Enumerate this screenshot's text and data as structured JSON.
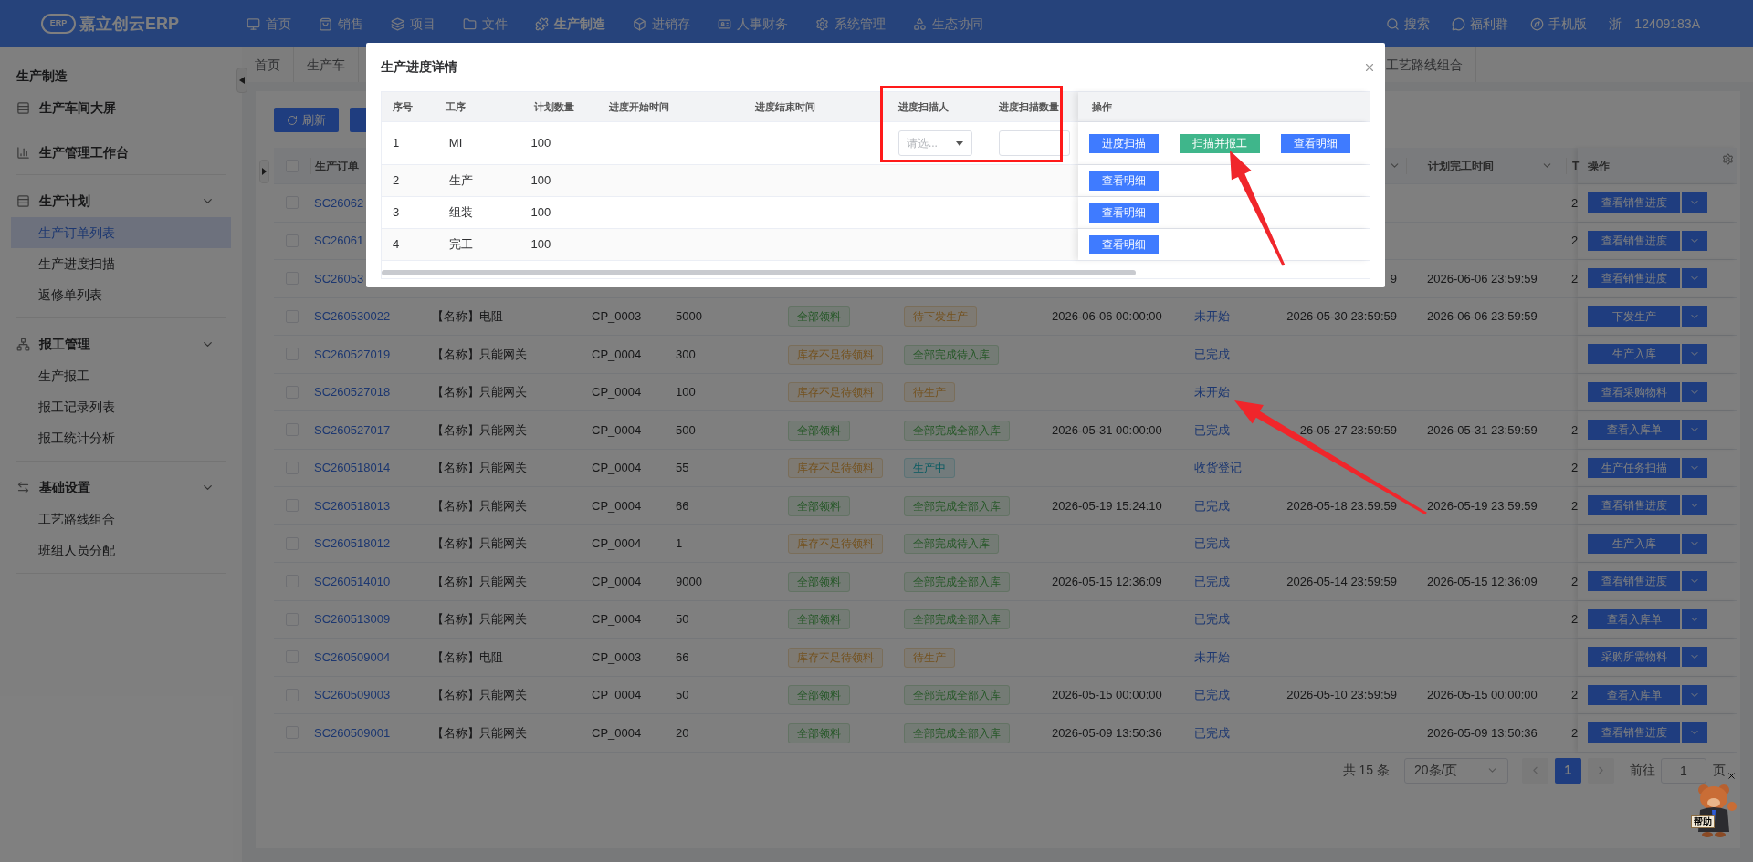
{
  "top_nav": {
    "logo": {
      "mark": "ERP",
      "name": "嘉立创云ERP"
    },
    "menu": [
      {
        "label": "首页",
        "selected": false
      },
      {
        "label": "销售",
        "selected": false
      },
      {
        "label": "项目",
        "selected": false
      },
      {
        "label": "文件",
        "selected": false
      },
      {
        "label": "生产制造",
        "selected": true
      },
      {
        "label": "进销存",
        "selected": false
      },
      {
        "label": "人事财务",
        "selected": false
      },
      {
        "label": "系统管理",
        "selected": false
      },
      {
        "label": "生态协同",
        "selected": false
      }
    ],
    "tools": [
      "搜索",
      "福利群",
      "手机版"
    ],
    "region": "浙",
    "user": "12409183A"
  },
  "sidebar": {
    "title": "生产制造",
    "items": [
      {
        "label": "生产车间大屏"
      },
      {
        "label": "生产管理工作台"
      },
      {
        "label": "生产计划",
        "expanded": true,
        "children": [
          {
            "label": "生产订单列表",
            "selected": true
          },
          {
            "label": "生产进度扫描",
            "selected": false
          },
          {
            "label": "返修单列表",
            "selected": false
          }
        ]
      },
      {
        "label": "报工管理",
        "expanded": true,
        "children": [
          {
            "label": "生产报工",
            "selected": false
          },
          {
            "label": "报工记录列表",
            "selected": false
          },
          {
            "label": "报工统计分析",
            "selected": false
          }
        ]
      },
      {
        "label": "基础设置",
        "expanded": true,
        "children": [
          {
            "label": "工艺路线组合",
            "selected": false
          },
          {
            "label": "班组人员分配",
            "selected": false
          }
        ]
      }
    ]
  },
  "tabs": [
    {
      "label": "首页"
    },
    {
      "label": "生产车"
    },
    {
      "label": "工艺路线组合"
    }
  ],
  "toolbar": {
    "buttons": [
      "刷新"
    ]
  },
  "table": {
    "select_all_checked": false,
    "columns": {
      "order_no": "生产订单",
      "planned_finish": "计划完工时间",
      "column_12": "T",
      "actions": "操作"
    },
    "rows": [
      {
        "checked": false,
        "order_no": "SC26062",
        "column_12": "2",
        "action": "查看销售进度"
      },
      {
        "checked": false,
        "order_no": "SC26061",
        "column_12": "2",
        "action": "查看销售进度"
      },
      {
        "checked": false,
        "order_no": "SC26053",
        "column_10": "9",
        "planned_finish": "2026-06-06 23:59:59",
        "column_12": "2",
        "action": "查看销售进度"
      },
      {
        "checked": false,
        "order_no": "SC260530022",
        "column_3": "【名称】电阻",
        "column_4": "CP_0003",
        "column_5": "5000",
        "column_6": {
          "text": "全部领料",
          "kind": "success"
        },
        "column_7": {
          "text": "待下发生产",
          "kind": "warning"
        },
        "column_8": "2026-06-06 00:00:00",
        "column_9": "未开始",
        "column_10": "2026-05-30 23:59:59",
        "planned_finish": "2026-06-06 23:59:59",
        "action": "下发生产"
      },
      {
        "checked": false,
        "order_no": "SC260527019",
        "column_3": "【名称】只能网关",
        "column_4": "CP_0004",
        "column_5": "300",
        "column_6": {
          "text": "库存不足待领料",
          "kind": "warning"
        },
        "column_7": {
          "text": "全部完成待入库",
          "kind": "success"
        },
        "column_9": "已完成",
        "action": "生产入库"
      },
      {
        "checked": false,
        "order_no": "SC260527018",
        "column_3": "【名称】只能网关",
        "column_4": "CP_0004",
        "column_5": "100",
        "column_6": {
          "text": "库存不足待领料",
          "kind": "warning"
        },
        "column_7": {
          "text": "待生产",
          "kind": "warning"
        },
        "column_9": "未开始",
        "action": "查看采购物料"
      },
      {
        "checked": false,
        "order_no": "SC260527017",
        "column_3": "【名称】只能网关",
        "column_4": "CP_0004",
        "column_5": "500",
        "column_6": {
          "text": "全部领料",
          "kind": "success"
        },
        "column_7": {
          "text": "全部完成全部入库",
          "kind": "success"
        },
        "column_8": "2026-05-31 00:00:00",
        "column_9": "已完成",
        "column_10": "26-05-27 23:59:59",
        "planned_finish": "2026-05-31 23:59:59",
        "column_12": "2",
        "action": "查看入库单"
      },
      {
        "checked": false,
        "order_no": "SC260518014",
        "column_3": "【名称】只能网关",
        "column_4": "CP_0004",
        "column_5": "55",
        "column_6": {
          "text": "库存不足待领料",
          "kind": "warning"
        },
        "column_7": {
          "text": "生产中",
          "kind": "info"
        },
        "column_9": "收货登记",
        "column_12": "2",
        "action": "生产任务扫描"
      },
      {
        "checked": false,
        "order_no": "SC260518013",
        "column_3": "【名称】只能网关",
        "column_4": "CP_0004",
        "column_5": "66",
        "column_6": {
          "text": "全部领料",
          "kind": "success"
        },
        "column_7": {
          "text": "全部完成全部入库",
          "kind": "success"
        },
        "column_8": "2026-05-19 15:24:10",
        "column_9": "已完成",
        "column_10": "2026-05-18 23:59:59",
        "planned_finish": "2026-05-19 23:59:59",
        "column_12": "2",
        "action": "查看销售进度"
      },
      {
        "checked": false,
        "order_no": "SC260518012",
        "column_3": "【名称】只能网关",
        "column_4": "CP_0004",
        "column_5": "1",
        "column_6": {
          "text": "库存不足待领料",
          "kind": "warning"
        },
        "column_7": {
          "text": "全部完成待入库",
          "kind": "success"
        },
        "column_9": "已完成",
        "action": "生产入库"
      },
      {
        "checked": false,
        "order_no": "SC260514010",
        "column_3": "【名称】只能网关",
        "column_4": "CP_0004",
        "column_5": "9000",
        "column_6": {
          "text": "全部领料",
          "kind": "success"
        },
        "column_7": {
          "text": "全部完成全部入库",
          "kind": "success"
        },
        "column_8": "2026-05-15 12:36:09",
        "column_9": "已完成",
        "column_10": "2026-05-14 23:59:59",
        "planned_finish": "2026-05-15 12:36:09",
        "column_12": "2",
        "action": "查看销售进度"
      },
      {
        "checked": false,
        "order_no": "SC260513009",
        "column_3": "【名称】只能网关",
        "column_4": "CP_0004",
        "column_5": "50",
        "column_6": {
          "text": "全部领料",
          "kind": "success"
        },
        "column_7": {
          "text": "全部完成全部入库",
          "kind": "success"
        },
        "column_9": "已完成",
        "column_12": "2",
        "action": "查看入库单"
      },
      {
        "checked": false,
        "order_no": "SC260509004",
        "column_3": "【名称】电阻",
        "column_4": "CP_0003",
        "column_5": "66",
        "column_6": {
          "text": "库存不足待领料",
          "kind": "warning"
        },
        "column_7": {
          "text": "待生产",
          "kind": "warning"
        },
        "column_9": "未开始",
        "action": "采购所需物料"
      },
      {
        "checked": false,
        "order_no": "SC260509003",
        "column_3": "【名称】只能网关",
        "column_4": "CP_0004",
        "column_5": "50",
        "column_6": {
          "text": "全部领料",
          "kind": "success"
        },
        "column_7": {
          "text": "全部完成全部入库",
          "kind": "success"
        },
        "column_8": "2026-05-15 00:00:00",
        "column_9": "已完成",
        "column_10": "2026-05-10 23:59:59",
        "planned_finish": "2026-05-15 00:00:00",
        "column_12": "2",
        "action": "查看入库单"
      },
      {
        "checked": false,
        "order_no": "SC260509001",
        "column_3": "【名称】只能网关",
        "column_4": "CP_0004",
        "column_5": "20",
        "column_6": {
          "text": "全部领料",
          "kind": "success"
        },
        "column_7": {
          "text": "全部完成全部入库",
          "kind": "success"
        },
        "column_8": "2026-05-09 13:50:36",
        "column_9": "已完成",
        "planned_finish": "2026-05-09 13:50:36",
        "column_12": "2",
        "action": "查看销售进度"
      }
    ]
  },
  "pagination": {
    "total": "共 15 条",
    "page_size": "20条/页",
    "pages": [
      {
        "label": "1",
        "selected": true
      }
    ],
    "goto_label": "前往",
    "goto_value": "1",
    "goto_suffix": "页"
  },
  "modal": {
    "title": "生产进度详情",
    "columns": [
      "序号",
      "工序",
      "计划数量",
      "进度开始时间",
      "进度结束时间",
      "进度扫描人",
      "进度扫描数量",
      "操作"
    ],
    "rows": [
      {
        "kind": "editable",
        "index": "1",
        "process": "MI",
        "planned_qty": "100",
        "scanner_placeholder": "请选...",
        "actions": [
          {
            "label": "进度扫描",
            "kind": "primary"
          },
          {
            "label": "扫描并报工",
            "kind": "success"
          },
          {
            "label": "查看明细",
            "kind": "primary"
          }
        ]
      },
      {
        "kind": "plain",
        "index": "2",
        "process": "生产",
        "planned_qty": "100",
        "actions": [
          {
            "label": "查看明细",
            "kind": "primary"
          }
        ]
      },
      {
        "kind": "plain",
        "index": "3",
        "process": "组装",
        "planned_qty": "100",
        "actions": [
          {
            "label": "查看明细",
            "kind": "primary"
          }
        ]
      },
      {
        "kind": "plain",
        "index": "4",
        "process": "完工",
        "planned_qty": "100",
        "actions": [
          {
            "label": "查看明细",
            "kind": "primary"
          }
        ]
      }
    ]
  },
  "help_widget": {
    "label": "帮助"
  }
}
